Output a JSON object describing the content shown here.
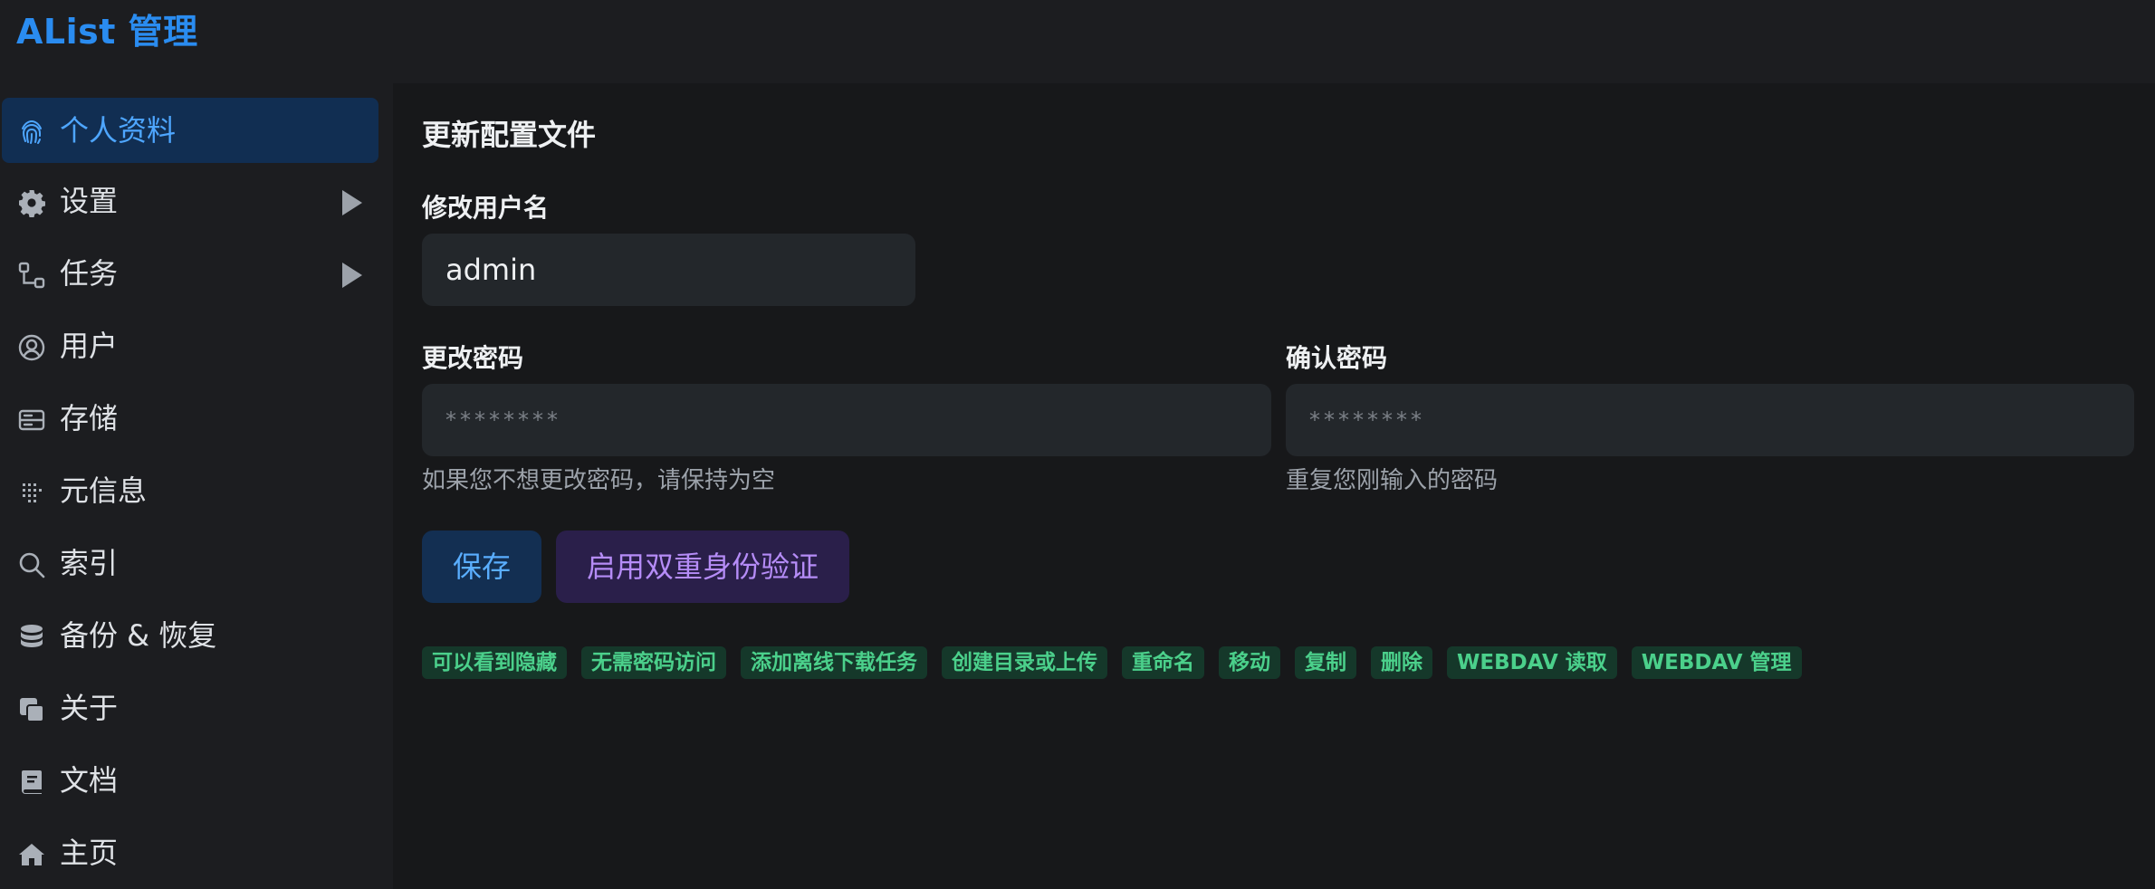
{
  "app": {
    "title": "AList 管理"
  },
  "sidebar": {
    "items": [
      {
        "label": "个人资料",
        "icon": "fingerprint-icon",
        "active": true
      },
      {
        "label": "设置",
        "icon": "gear-icon",
        "expandable": true
      },
      {
        "label": "任务",
        "icon": "task-tree-icon",
        "expandable": true
      },
      {
        "label": "用户",
        "icon": "user-circle-icon"
      },
      {
        "label": "存储",
        "icon": "storage-icon"
      },
      {
        "label": "元信息",
        "icon": "meta-grid-icon"
      },
      {
        "label": "索引",
        "icon": "search-icon"
      },
      {
        "label": "备份 & 恢复",
        "icon": "database-icon"
      },
      {
        "label": "关于",
        "icon": "copy-icon"
      },
      {
        "label": "文档",
        "icon": "book-icon"
      },
      {
        "label": "主页",
        "icon": "home-icon"
      }
    ]
  },
  "profile": {
    "section_title": "更新配置文件",
    "username_label": "修改用户名",
    "username_value": "admin",
    "password_label": "更改密码",
    "password_placeholder": "********",
    "password_help": "如果您不想更改密码，请保持为空",
    "confirm_label": "确认密码",
    "confirm_placeholder": "********",
    "confirm_help": "重复您刚输入的密码",
    "save_label": "保存",
    "two_factor_label": "启用双重身份验证",
    "permissions": [
      "可以看到隐藏",
      "无需密码访问",
      "添加离线下载任务",
      "创建目录或上传",
      "重命名",
      "移动",
      "复制",
      "删除",
      "WEBDAV 读取",
      "WEBDAV 管理"
    ]
  },
  "colors": {
    "accent": "#2a8cf0",
    "active_bg": "#112e52",
    "purple_btn": "#2a1f4a",
    "purple_text": "#b58cf7",
    "perm_bg": "#15382a",
    "perm_text": "#4bd08b"
  }
}
